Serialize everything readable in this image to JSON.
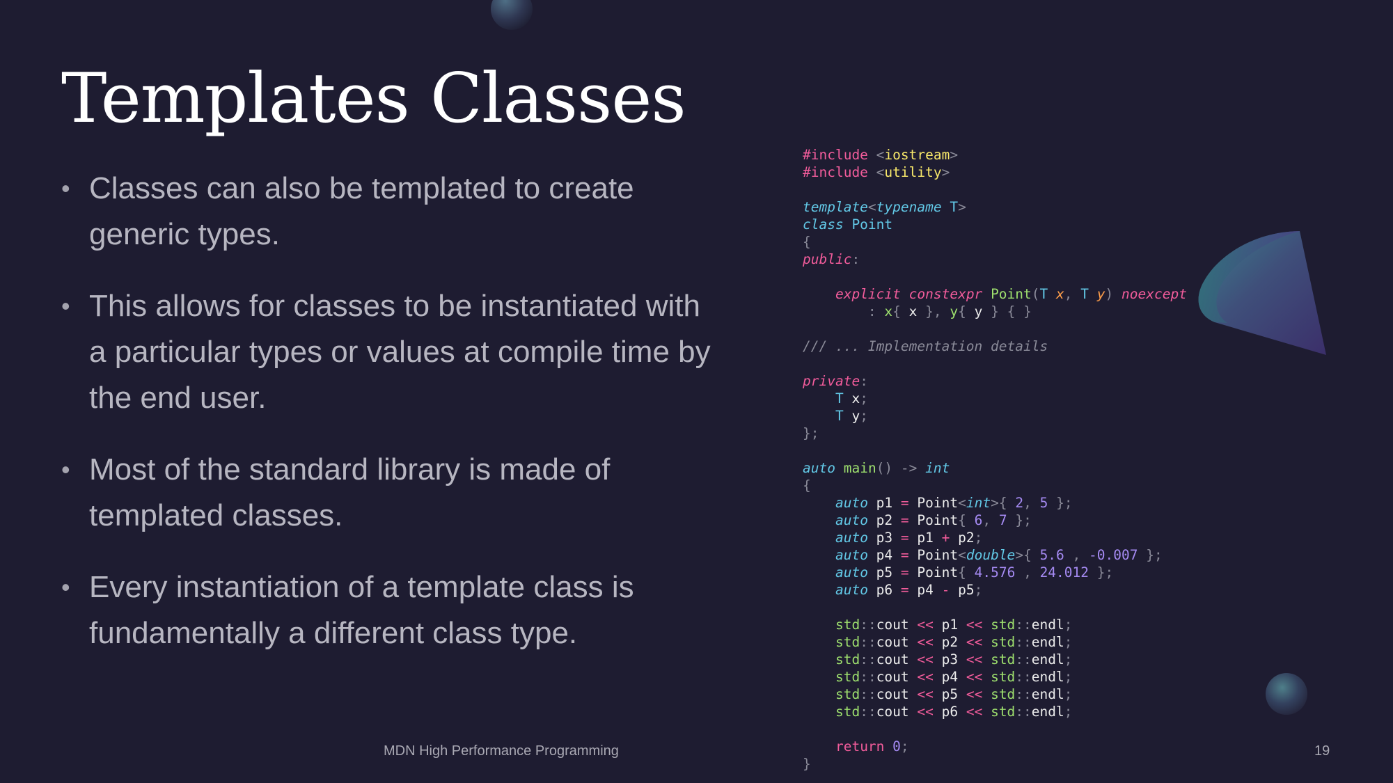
{
  "slide": {
    "title": "Templates Classes",
    "bullets": [
      "Classes can also be templated to create generic types.",
      "This allows for classes to be instantiated with a particular types or values at compile time by the end user.",
      "Most of the standard library is made of templated classes.",
      "Every instantiation of a template class is fundamentally a different class type."
    ],
    "bullet_symbol": "•",
    "footer": "MDN High Performance Programming",
    "page_number": "19"
  },
  "code_lines": [
    [
      [
        "pp",
        "#include "
      ],
      [
        "pn",
        "<"
      ],
      [
        "inc",
        "iostream"
      ],
      [
        "pn",
        ">"
      ]
    ],
    [
      [
        "pp",
        "#include "
      ],
      [
        "pn",
        "<"
      ],
      [
        "inc",
        "utility"
      ],
      [
        "pn",
        ">"
      ]
    ],
    [],
    [
      [
        "kw",
        "template"
      ],
      [
        "pn",
        "<"
      ],
      [
        "kw",
        "typename"
      ],
      [
        "ty",
        " T"
      ],
      [
        "pn",
        ">"
      ]
    ],
    [
      [
        "kw",
        "class"
      ],
      [
        "ty",
        " Point"
      ]
    ],
    [
      [
        "pn",
        "{"
      ]
    ],
    [
      [
        "kwr",
        "public"
      ],
      [
        "pn",
        ":"
      ]
    ],
    [],
    [
      [
        "id",
        "    "
      ],
      [
        "kwr",
        "explicit"
      ],
      [
        "id",
        " "
      ],
      [
        "kwr",
        "constexpr"
      ],
      [
        "id",
        " "
      ],
      [
        "fn",
        "Point"
      ],
      [
        "pn",
        "("
      ],
      [
        "ty",
        "T"
      ],
      [
        "id",
        " "
      ],
      [
        "prm",
        "x"
      ],
      [
        "pn",
        ","
      ],
      [
        "id",
        " "
      ],
      [
        "ty",
        "T"
      ],
      [
        "id",
        " "
      ],
      [
        "prm",
        "y"
      ],
      [
        "pn",
        ")"
      ],
      [
        "id",
        " "
      ],
      [
        "kwr",
        "noexcept"
      ]
    ],
    [
      [
        "id",
        "        "
      ],
      [
        "pn",
        ": "
      ],
      [
        "fn",
        "x"
      ],
      [
        "pn",
        "{"
      ],
      [
        "id",
        " x "
      ],
      [
        "pn",
        "}"
      ],
      [
        "pn",
        ","
      ],
      [
        "id",
        " "
      ],
      [
        "fn",
        "y"
      ],
      [
        "pn",
        "{"
      ],
      [
        "id",
        " y "
      ],
      [
        "pn",
        "}"
      ],
      [
        "id",
        " "
      ],
      [
        "pn",
        "{"
      ],
      [
        "id",
        " "
      ],
      [
        "pn",
        "}"
      ]
    ],
    [],
    [
      [
        "cm",
        "/// ... Implementation details"
      ]
    ],
    [],
    [
      [
        "kwr",
        "private"
      ],
      [
        "pn",
        ":"
      ]
    ],
    [
      [
        "id",
        "    "
      ],
      [
        "ty",
        "T"
      ],
      [
        "id",
        " x"
      ],
      [
        "pn",
        ";"
      ]
    ],
    [
      [
        "id",
        "    "
      ],
      [
        "ty",
        "T"
      ],
      [
        "id",
        " y"
      ],
      [
        "pn",
        ";"
      ]
    ],
    [
      [
        "pn",
        "};"
      ]
    ],
    [],
    [
      [
        "kw",
        "auto"
      ],
      [
        "id",
        " "
      ],
      [
        "fn",
        "main"
      ],
      [
        "pn",
        "()"
      ],
      [
        "id",
        " "
      ],
      [
        "pn",
        "->"
      ],
      [
        "id",
        " "
      ],
      [
        "kw",
        "int"
      ]
    ],
    [
      [
        "pn",
        "{"
      ]
    ],
    [
      [
        "id",
        "    "
      ],
      [
        "kw",
        "auto"
      ],
      [
        "id",
        " p1 "
      ],
      [
        "op",
        "="
      ],
      [
        "id",
        " Point"
      ],
      [
        "pn",
        "<"
      ],
      [
        "kw",
        "int"
      ],
      [
        "pn",
        ">"
      ],
      [
        "pn",
        "{"
      ],
      [
        "id",
        " "
      ],
      [
        "num",
        "2"
      ],
      [
        "pn",
        ","
      ],
      [
        "id",
        " "
      ],
      [
        "num",
        "5"
      ],
      [
        "id",
        " "
      ],
      [
        "pn",
        "};"
      ]
    ],
    [
      [
        "id",
        "    "
      ],
      [
        "kw",
        "auto"
      ],
      [
        "id",
        " p2 "
      ],
      [
        "op",
        "="
      ],
      [
        "id",
        " Point"
      ],
      [
        "pn",
        "{"
      ],
      [
        "id",
        " "
      ],
      [
        "num",
        "6"
      ],
      [
        "pn",
        ","
      ],
      [
        "id",
        " "
      ],
      [
        "num",
        "7"
      ],
      [
        "id",
        " "
      ],
      [
        "pn",
        "};"
      ]
    ],
    [
      [
        "id",
        "    "
      ],
      [
        "kw",
        "auto"
      ],
      [
        "id",
        " p3 "
      ],
      [
        "op",
        "="
      ],
      [
        "id",
        " p1 "
      ],
      [
        "op",
        "+"
      ],
      [
        "id",
        " p2"
      ],
      [
        "pn",
        ";"
      ]
    ],
    [
      [
        "id",
        "    "
      ],
      [
        "kw",
        "auto"
      ],
      [
        "id",
        " p4 "
      ],
      [
        "op",
        "="
      ],
      [
        "id",
        " Point"
      ],
      [
        "pn",
        "<"
      ],
      [
        "kw",
        "double"
      ],
      [
        "pn",
        ">"
      ],
      [
        "pn",
        "{"
      ],
      [
        "id",
        " "
      ],
      [
        "num",
        "5.6"
      ],
      [
        "id",
        " "
      ],
      [
        "pn",
        ","
      ],
      [
        "id",
        " "
      ],
      [
        "num",
        "-0.007"
      ],
      [
        "id",
        " "
      ],
      [
        "pn",
        "};"
      ]
    ],
    [
      [
        "id",
        "    "
      ],
      [
        "kw",
        "auto"
      ],
      [
        "id",
        " p5 "
      ],
      [
        "op",
        "="
      ],
      [
        "id",
        " Point"
      ],
      [
        "pn",
        "{"
      ],
      [
        "id",
        " "
      ],
      [
        "num",
        "4.576"
      ],
      [
        "id",
        " "
      ],
      [
        "pn",
        ","
      ],
      [
        "id",
        " "
      ],
      [
        "num",
        "24.012"
      ],
      [
        "id",
        " "
      ],
      [
        "pn",
        "};"
      ]
    ],
    [
      [
        "id",
        "    "
      ],
      [
        "kw",
        "auto"
      ],
      [
        "id",
        " p6 "
      ],
      [
        "op",
        "="
      ],
      [
        "id",
        " p4 "
      ],
      [
        "op",
        "-"
      ],
      [
        "id",
        " p5"
      ],
      [
        "pn",
        ";"
      ]
    ],
    [],
    [
      [
        "id",
        "    "
      ],
      [
        "ns",
        "std"
      ],
      [
        "pn",
        "::"
      ],
      [
        "id",
        "cout "
      ],
      [
        "op",
        "<<"
      ],
      [
        "id",
        " p1 "
      ],
      [
        "op",
        "<<"
      ],
      [
        "id",
        " "
      ],
      [
        "ns",
        "std"
      ],
      [
        "pn",
        "::"
      ],
      [
        "id",
        "endl"
      ],
      [
        "pn",
        ";"
      ]
    ],
    [
      [
        "id",
        "    "
      ],
      [
        "ns",
        "std"
      ],
      [
        "pn",
        "::"
      ],
      [
        "id",
        "cout "
      ],
      [
        "op",
        "<<"
      ],
      [
        "id",
        " p2 "
      ],
      [
        "op",
        "<<"
      ],
      [
        "id",
        " "
      ],
      [
        "ns",
        "std"
      ],
      [
        "pn",
        "::"
      ],
      [
        "id",
        "endl"
      ],
      [
        "pn",
        ";"
      ]
    ],
    [
      [
        "id",
        "    "
      ],
      [
        "ns",
        "std"
      ],
      [
        "pn",
        "::"
      ],
      [
        "id",
        "cout "
      ],
      [
        "op",
        "<<"
      ],
      [
        "id",
        " p3 "
      ],
      [
        "op",
        "<<"
      ],
      [
        "id",
        " "
      ],
      [
        "ns",
        "std"
      ],
      [
        "pn",
        "::"
      ],
      [
        "id",
        "endl"
      ],
      [
        "pn",
        ";"
      ]
    ],
    [
      [
        "id",
        "    "
      ],
      [
        "ns",
        "std"
      ],
      [
        "pn",
        "::"
      ],
      [
        "id",
        "cout "
      ],
      [
        "op",
        "<<"
      ],
      [
        "id",
        " p4 "
      ],
      [
        "op",
        "<<"
      ],
      [
        "id",
        " "
      ],
      [
        "ns",
        "std"
      ],
      [
        "pn",
        "::"
      ],
      [
        "id",
        "endl"
      ],
      [
        "pn",
        ";"
      ]
    ],
    [
      [
        "id",
        "    "
      ],
      [
        "ns",
        "std"
      ],
      [
        "pn",
        "::"
      ],
      [
        "id",
        "cout "
      ],
      [
        "op",
        "<<"
      ],
      [
        "id",
        " p5 "
      ],
      [
        "op",
        "<<"
      ],
      [
        "id",
        " "
      ],
      [
        "ns",
        "std"
      ],
      [
        "pn",
        "::"
      ],
      [
        "id",
        "endl"
      ],
      [
        "pn",
        ";"
      ]
    ],
    [
      [
        "id",
        "    "
      ],
      [
        "ns",
        "std"
      ],
      [
        "pn",
        "::"
      ],
      [
        "id",
        "cout "
      ],
      [
        "op",
        "<<"
      ],
      [
        "id",
        " p6 "
      ],
      [
        "op",
        "<<"
      ],
      [
        "id",
        " "
      ],
      [
        "ns",
        "std"
      ],
      [
        "pn",
        "::"
      ],
      [
        "id",
        "endl"
      ],
      [
        "pn",
        ";"
      ]
    ],
    [],
    [
      [
        "id",
        "    "
      ],
      [
        "ret",
        "return"
      ],
      [
        "id",
        " "
      ],
      [
        "num",
        "0"
      ],
      [
        "pn",
        ";"
      ]
    ],
    [
      [
        "pn",
        "}"
      ]
    ]
  ],
  "colors": {
    "background": "#1e1c31",
    "title": "#ffffff",
    "body_text": "#b7b6c1",
    "keyword": "#62c8e6",
    "keyword_alt": "#f25c9b",
    "function": "#9ee06e",
    "number": "#a58af2",
    "include_target": "#f8e86a",
    "parameter": "#ff9e4a",
    "comment": "#8a8a98"
  }
}
